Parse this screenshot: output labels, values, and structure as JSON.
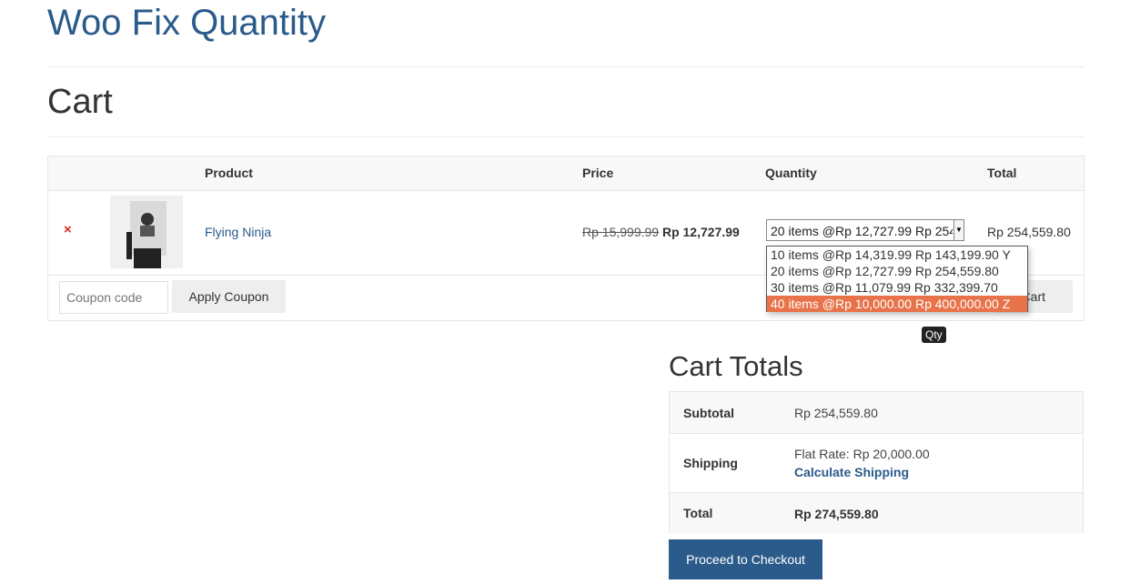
{
  "site": {
    "title": "Woo Fix Quantity"
  },
  "page": {
    "title": "Cart"
  },
  "cart": {
    "headers": {
      "product": "Product",
      "price": "Price",
      "quantity": "Quantity",
      "total": "Total"
    },
    "items": [
      {
        "remove_symbol": "×",
        "name": "Flying Ninja",
        "old_price": "Rp 15,999.99",
        "price": "Rp 12,727.99",
        "quantity_selected": "20 items @Rp 12,727.99 Rp 254,559.80",
        "total": "Rp 254,559.80"
      }
    ],
    "quantity_options": [
      "10 items @Rp 14,319.99 Rp 143,199.90 Y",
      "20 items @Rp 12,727.99 Rp 254,559.80",
      "30 items @Rp 11,079.99 Rp 332,399.70",
      "40 items @Rp 10,000.00 Rp 400,000.00 Z"
    ],
    "highlighted_option_index": 3,
    "coupon": {
      "placeholder": "Coupon code",
      "apply_label": "Apply Coupon"
    },
    "update_label": "Cart",
    "tooltip": "Qty"
  },
  "totals": {
    "title": "Cart Totals",
    "subtotal_label": "Subtotal",
    "subtotal_value": "Rp 254,559.80",
    "shipping_label": "Shipping",
    "shipping_value": "Flat Rate: Rp 20,000.00",
    "calculate_shipping": "Calculate Shipping",
    "total_label": "Total",
    "total_value": "Rp 274,559.80",
    "checkout_label": "Proceed to Checkout"
  },
  "colors": {
    "link": "#2b5b8a",
    "highlight": "#e8734a",
    "remove": "#e2251b"
  },
  "icons": {
    "remove": "remove-x-icon",
    "select_arrow": "chevron-down-icon"
  }
}
